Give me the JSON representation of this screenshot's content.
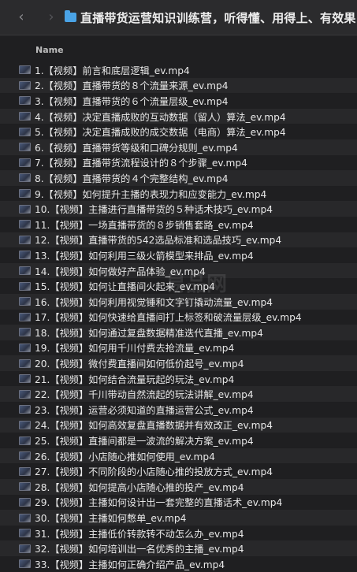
{
  "window": {
    "title": "直播带货运营知识训练营，听得懂、用得上、有效果",
    "back_icon": "chevron-left-icon",
    "forward_icon": "chevron-right-icon",
    "folder_color": "#4aa3e6"
  },
  "columns": {
    "name": "Name"
  },
  "files": [
    "1.【视频】前言和底层逻辑_ev.mp4",
    "2.【视频】直播带货的８个流量来源_ev.mp4",
    "3.【视频】直播带货的６个流量层级_ev.mp4",
    "4.【视频】决定直播成败的互动数据（留人）算法_ev.mp4",
    "5.【视频】决定直播成败的成交数据（电商）算法_ev.mp4",
    "6.【视频】直播带货等级和口碑分规则_ev.mp4",
    "7.【视频】直播带货流程设计的８个步骤_ev.mp4",
    "8.【视频】直播带货的４个完整结构_ev.mp4",
    "9.【视频】如何提升主播的表现力和应变能力_ev.mp4",
    "10.【视频】主播进行直播带货的５种话术技巧_ev.mp4",
    "11.【视频】一场直播带货的８步销售套路_ev.mp4",
    "12.【视频】直播带货的542选品标准和选品技巧_ev.mp4",
    "13.【视频】如何利用三级火箭模型来排品_ev.mp4",
    "14.【视频】如何做好产品体验_ev.mp4",
    "15.【视频】如何让直播间火起来_ev.mp4",
    "16.【视频】如何利用视觉锤和文字钉撬动流量_ev.mp4",
    "17.【视频】如何快速给直播间打上标签和破流量层级_ev.mp4",
    "18.【视频】如何通过复盘数据精准迭代直播_ev.mp4",
    "19.【视频】如何用千川付费去抢流量_ev.mp4",
    "20.【视频】微付费直播间如何低价起号_ev.mp4",
    "21.【视频】如何结合流量玩起的玩法_ev.mp4",
    "22.【视频】千川带动自然流起的玩法讲解_ev.mp4",
    "23.【视频】运营必须知道的直播运营公式_ev.mp4",
    "24.【视频】如何高效复盘直播数据并有效改正_ev.mp4",
    "25.【视频】直播间都是一波流的解决方案_ev.mp4",
    "26.【视频】小店随心推如何使用_ev.mp4",
    "27.【视频】不同阶段的小店随心推的投放方式_ev.mp4",
    "28.【视频】如何提高小店随心推的投产_ev.mp4",
    "29.【视频】主播如何设计出一套完整的直播话术_ev.mp4",
    "30.【视频】主播如何憋单_ev.mp4",
    "31.【视频】主播低价转款转不动怎么办_ev.mp4",
    "32.【视频】如何培训出一名优秀的主播_ev.mp4",
    "33.【视频】主播如何正确介绍产品_ev.mp4"
  ],
  "file_icon": "video-thumbnail-icon",
  "watermark": "易品网"
}
